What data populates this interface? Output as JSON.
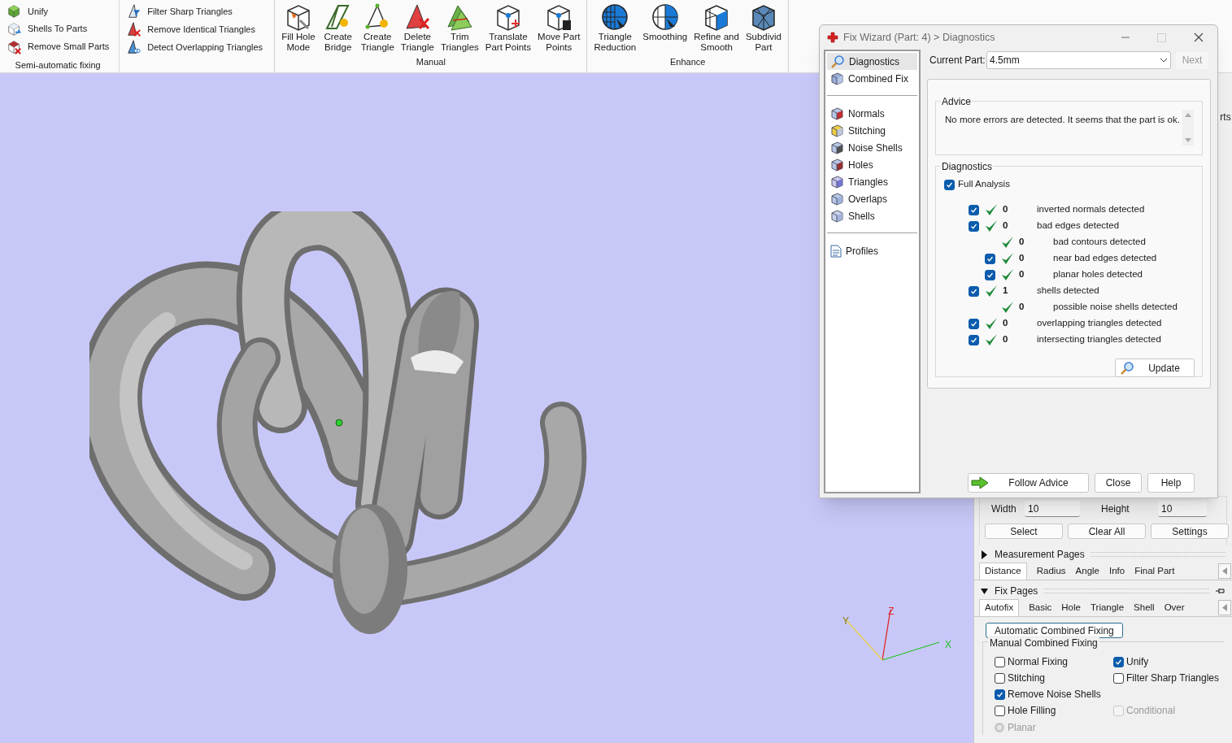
{
  "ribbon": {
    "groups": [
      {
        "kind": "small",
        "label": "Semi-automatic fixing",
        "columns": [
          [
            "Unify",
            "Shells To Parts",
            "Remove Small Parts"
          ],
          [
            "Filter Sharp Triangles",
            "Remove Identical Triangles",
            "Detect Overlapping Triangles"
          ]
        ]
      },
      {
        "kind": "large",
        "label": "Manual",
        "buttons": [
          [
            "Fill Hole",
            "Mode"
          ],
          [
            "Create",
            "Bridge"
          ],
          [
            "Create",
            "Triangle"
          ],
          [
            "Delete",
            "Triangle"
          ],
          [
            "Trim",
            "Triangles"
          ],
          [
            "Translate",
            "Part Points"
          ],
          [
            "Move Part",
            "Points"
          ]
        ]
      },
      {
        "kind": "large",
        "label": "Enhance",
        "buttons": [
          [
            "Triangle",
            "Reduction"
          ],
          [
            "Smoothing"
          ],
          [
            "Refine and",
            "Smooth"
          ],
          [
            "Subdivid",
            "Part"
          ]
        ]
      }
    ]
  },
  "viewport": {
    "axes": [
      {
        "label": "Z",
        "color": "#e02828"
      },
      {
        "label": "X",
        "color": "#22c022"
      },
      {
        "label": "Y",
        "color": "#e8d048"
      }
    ]
  },
  "dialog": {
    "title": "Fix Wizard (Part: 4) > Diagnostics",
    "nav": [
      [
        {
          "label": "Diagnostics",
          "selected": true
        },
        {
          "label": "Combined Fix",
          "selected": false
        }
      ],
      [
        {
          "label": "Normals",
          "selected": false
        },
        {
          "label": "Stitching",
          "selected": false
        },
        {
          "label": "Noise Shells",
          "selected": false
        },
        {
          "label": "Holes",
          "selected": false
        },
        {
          "label": "Triangles",
          "selected": false
        },
        {
          "label": "Overlaps",
          "selected": false
        },
        {
          "label": "Shells",
          "selected": false
        }
      ],
      [
        {
          "label": "Profiles",
          "selected": false
        }
      ]
    ],
    "current_part": {
      "label": "Current Part:",
      "value": "4.5mm"
    },
    "next_button": {
      "label": "Next",
      "disabled": true
    },
    "advice": {
      "title": "Advice",
      "text": "No more errors are detected. It seems that the part is ok."
    },
    "diagnostics": {
      "title": "Diagnostics",
      "full_analysis": {
        "label": "Full Analysis",
        "checked": true
      },
      "rows": [
        {
          "kind": "checkable",
          "checked": true,
          "count": "0",
          "label": "inverted normals detected"
        },
        {
          "kind": "checkable",
          "checked": true,
          "count": "0",
          "label": "bad edges detected",
          "children": [
            {
              "kind": "plain",
              "count": "0",
              "label": "bad contours detected"
            },
            {
              "kind": "checkable",
              "checked": true,
              "count": "0",
              "label": "near bad edges detected"
            },
            {
              "kind": "checkable",
              "checked": true,
              "count": "0",
              "label": "planar holes detected"
            }
          ]
        },
        {
          "kind": "checkable",
          "checked": true,
          "count": "1",
          "label": "shells detected",
          "children": [
            {
              "kind": "plain",
              "count": "0",
              "label": "possible noise shells detected"
            }
          ]
        },
        {
          "kind": "checkable",
          "checked": true,
          "count": "0",
          "label": "overlapping triangles detected"
        },
        {
          "kind": "checkable",
          "checked": true,
          "count": "0",
          "label": "intersecting triangles detected"
        }
      ]
    },
    "update_button": "Update",
    "buttons": [
      "Follow Advice",
      "Close",
      "Help"
    ]
  },
  "side_panel": {
    "fragment": "rts:",
    "width": {
      "label": "Width",
      "value": "10"
    },
    "height": {
      "label": "Height",
      "value": "10"
    },
    "buttons": [
      "Select",
      "Clear All",
      "Settings"
    ],
    "sections": [
      {
        "title": "Measurement Pages",
        "expanded": false,
        "tabs": [
          {
            "label": "Distance",
            "selected": true
          },
          {
            "label": "Radius",
            "selected": false
          },
          {
            "label": "Angle",
            "selected": false
          },
          {
            "label": "Info",
            "selected": false
          },
          {
            "label": "Final Part",
            "selected": false
          }
        ]
      },
      {
        "title": "Fix Pages",
        "expanded": true,
        "tabs": [
          {
            "label": "Autofix",
            "selected": true
          },
          {
            "label": "Basic",
            "selected": false
          },
          {
            "label": "Hole",
            "selected": false
          },
          {
            "label": "Triangle",
            "selected": false
          },
          {
            "label": "Shell",
            "selected": false
          },
          {
            "label": "Over",
            "selected": false
          }
        ]
      }
    ],
    "autofix": {
      "button": "Automatic Combined Fixing",
      "group_title": "Manual Combined Fixing",
      "options": [
        [
          {
            "label": "Normal Fixing",
            "checked": false,
            "disabled": false
          },
          {
            "label": "Unify",
            "checked": true,
            "disabled": false
          }
        ],
        [
          {
            "label": "Stitching",
            "checked": false,
            "disabled": false
          },
          {
            "label": "Filter Sharp Triangles",
            "checked": false,
            "disabled": false
          }
        ],
        [
          {
            "label": "Remove Noise Shells",
            "checked": true,
            "disabled": false
          }
        ],
        [
          {
            "label": "Hole Filling",
            "checked": false,
            "disabled": false
          },
          {
            "label": "Conditional",
            "checked": false,
            "disabled": true
          }
        ]
      ],
      "radio": {
        "label": "Planar",
        "selected": false,
        "disabled": true
      }
    }
  }
}
